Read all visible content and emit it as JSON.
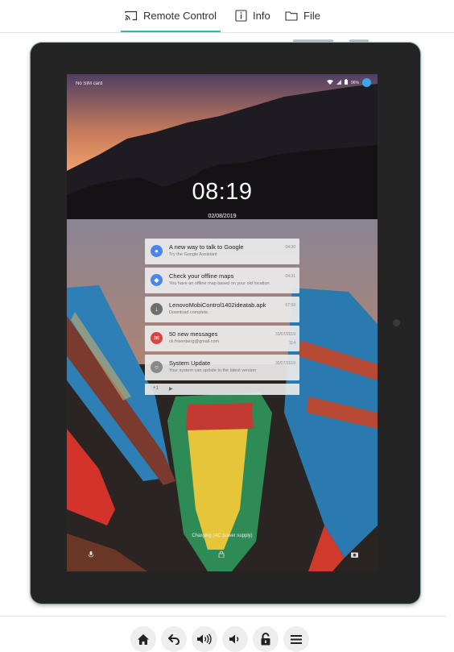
{
  "tabs": [
    {
      "label": "Remote Control",
      "icon": "cast-icon",
      "active": true
    },
    {
      "label": "Info",
      "icon": "info-icon",
      "active": false
    },
    {
      "label": "File",
      "icon": "folder-icon",
      "active": false
    }
  ],
  "colors": {
    "accent": "#3bb3a6",
    "tablet_frame": "#242424",
    "toolbar_button_bg": "#eeeeee"
  },
  "device_screen": {
    "status_bar": {
      "sim_text": "No SIM card",
      "battery": "96%"
    },
    "clock": "08:19",
    "date": "02/08/2019",
    "notifications": [
      {
        "title": "A new way to talk to Google",
        "subtitle": "Try the Google Assistant",
        "time": "04:30",
        "extra": "",
        "icon": "assistant-icon",
        "icon_color": "#4a86e8"
      },
      {
        "title": "Check your offline maps",
        "subtitle": "You have an offline map based on your old location.",
        "time": "04:31",
        "extra": "",
        "icon": "maps-icon",
        "icon_color": "#4a86e8"
      },
      {
        "title": "LenovoMobiControl1402ideatab.apk",
        "subtitle": "Download complete.",
        "time": "07:59",
        "extra": "",
        "icon": "download-icon",
        "icon_color": "#6e6e6e"
      },
      {
        "title": "50 new messages",
        "subtitle": "ck.frisenberg@gmail.com",
        "time": "31/07/2019",
        "extra": "114",
        "icon": "mail-icon",
        "icon_color": "#d9453c"
      },
      {
        "title": "System Update",
        "subtitle": "Your system can update to the latest version",
        "time": "30/07/2019",
        "extra": "",
        "icon": "update-icon",
        "icon_color": "#8a8a8a"
      }
    ],
    "media_row": {
      "left": "+1",
      "right": "▶"
    },
    "charging_text": "Charging (AC power supply)"
  },
  "toolbar": {
    "buttons": [
      {
        "name": "home-button",
        "icon": "home-icon"
      },
      {
        "name": "back-button",
        "icon": "back-arrow-icon"
      },
      {
        "name": "volume-up-button",
        "icon": "volume-up-icon"
      },
      {
        "name": "volume-down-button",
        "icon": "volume-down-icon"
      },
      {
        "name": "unlock-button",
        "icon": "unlock-icon"
      },
      {
        "name": "menu-button",
        "icon": "menu-icon"
      }
    ]
  }
}
